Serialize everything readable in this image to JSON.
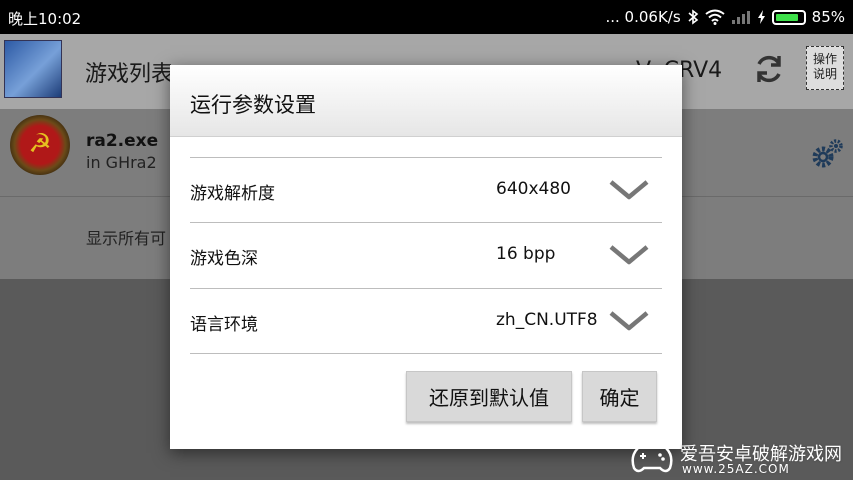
{
  "status_bar": {
    "time": "晚上10:02",
    "network_speed": "... 0.06K/s",
    "battery": "85%",
    "battery_level": 0.85,
    "icons": [
      "bluetooth-icon",
      "wifi-icon",
      "signal-icon",
      "charging-icon",
      "battery-icon"
    ]
  },
  "app": {
    "title": "游戏列表",
    "version": "V: CRV4",
    "help_label_line1": "操作",
    "help_label_line2": "说明",
    "game": {
      "name": "ra2.exe",
      "location": "in GHra2"
    },
    "show_all": "显示所有可"
  },
  "dialog": {
    "title": "运行参数设置",
    "rows": [
      {
        "label": "游戏解析度",
        "value": "640x480"
      },
      {
        "label": "游戏色深",
        "value": "16 bpp"
      },
      {
        "label": "语言环境",
        "value": "zh_CN.UTF8"
      }
    ],
    "reset_label": "还原到默认值",
    "ok_label": "确定"
  },
  "watermark": {
    "text": "爱吾安卓破解游戏网",
    "url": "www.25AZ.COM"
  },
  "colors": {
    "battery_fill": "#3ee04a",
    "dialog_bg": "#ffffff",
    "button_bg": "#d9d9d9",
    "dim_overlay": "#5a5a5a"
  }
}
